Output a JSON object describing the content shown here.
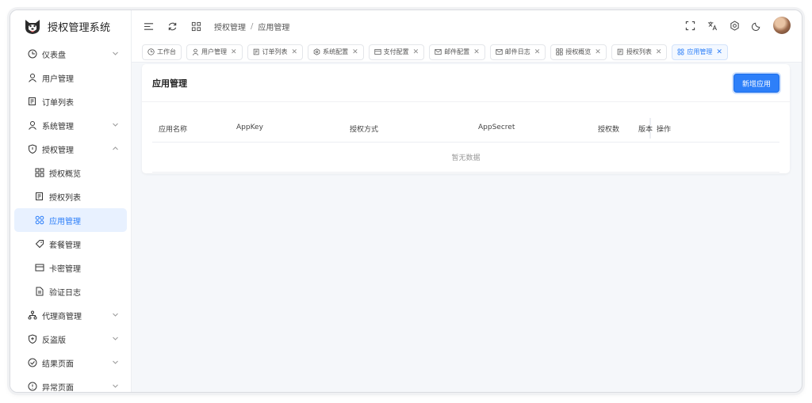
{
  "brand": {
    "title": "授权管理系统"
  },
  "sidebar": {
    "items": [
      {
        "label": "仪表盘",
        "icon": "dashboard-icon",
        "chevron": "down"
      },
      {
        "label": "用户管理",
        "icon": "user-icon"
      },
      {
        "label": "订单列表",
        "icon": "list-icon"
      },
      {
        "label": "系统管理",
        "icon": "user-icon",
        "chevron": "down"
      },
      {
        "label": "授权管理",
        "icon": "shield-icon",
        "chevron": "up"
      },
      {
        "label": "授权概览",
        "icon": "grid-icon",
        "sub": true
      },
      {
        "label": "授权列表",
        "icon": "list-icon",
        "sub": true
      },
      {
        "label": "应用管理",
        "icon": "apps-icon",
        "sub": true,
        "active": true
      },
      {
        "label": "套餐管理",
        "icon": "tag-icon",
        "sub": true
      },
      {
        "label": "卡密管理",
        "icon": "card-icon",
        "sub": true
      },
      {
        "label": "验证日志",
        "icon": "doc-icon",
        "sub": true
      },
      {
        "label": "代理商管理",
        "icon": "org-icon",
        "chevron": "down"
      },
      {
        "label": "反盗版",
        "icon": "shield-plus-icon",
        "chevron": "down"
      },
      {
        "label": "结果页面",
        "icon": "check-circle-icon",
        "chevron": "down"
      },
      {
        "label": "异常页面",
        "icon": "info-circle-icon",
        "chevron": "down"
      }
    ]
  },
  "breadcrumb": {
    "parent": "授权管理",
    "sep": "/",
    "current": "应用管理"
  },
  "tabs": [
    {
      "label": "工作台",
      "icon": "dashboard-icon",
      "closable": false
    },
    {
      "label": "用户管理",
      "icon": "user-icon",
      "closable": true
    },
    {
      "label": "订单列表",
      "icon": "list-icon",
      "closable": true
    },
    {
      "label": "系统配置",
      "icon": "gear-icon",
      "closable": true
    },
    {
      "label": "支付配置",
      "icon": "card-icon",
      "closable": true
    },
    {
      "label": "邮件配置",
      "icon": "mail-icon",
      "closable": true
    },
    {
      "label": "邮件日志",
      "icon": "mail-icon",
      "closable": true
    },
    {
      "label": "授权概览",
      "icon": "grid-icon",
      "closable": true
    },
    {
      "label": "授权列表",
      "icon": "list-icon",
      "closable": true
    },
    {
      "label": "应用管理",
      "icon": "apps-icon",
      "closable": true,
      "active": true
    }
  ],
  "main": {
    "title": "应用管理",
    "add_label": "新增应用",
    "columns": [
      "应用名称",
      "AppKey",
      "授权方式",
      "AppSecret",
      "授权数",
      "版本",
      "操作"
    ],
    "empty_text": "暂无数据"
  },
  "colors": {
    "accent": "#2d7ff9",
    "active_bg": "#e8f1ff"
  }
}
